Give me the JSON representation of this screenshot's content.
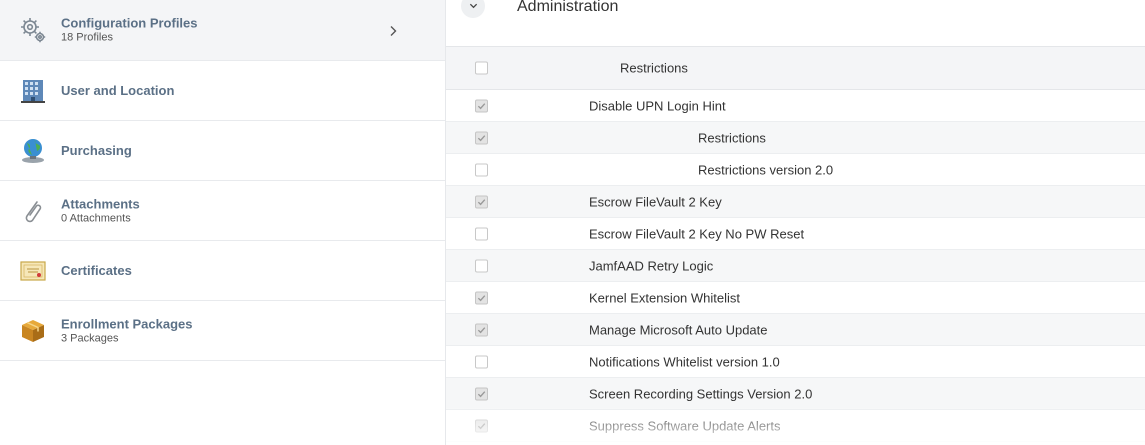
{
  "sidebar": {
    "items": [
      {
        "label": "Configuration Profiles",
        "sub": "18 Profiles",
        "icon": "gear-icon"
      },
      {
        "label": "User and Location",
        "sub": "",
        "icon": "building-icon"
      },
      {
        "label": "Purchasing",
        "sub": "",
        "icon": "globe-icon"
      },
      {
        "label": "Attachments",
        "sub": "0 Attachments",
        "icon": "paperclip-icon"
      },
      {
        "label": "Certificates",
        "sub": "",
        "icon": "certificate-icon"
      },
      {
        "label": "Enrollment Packages",
        "sub": "3 Packages",
        "icon": "package-icon"
      }
    ]
  },
  "main": {
    "section_title": "Administration",
    "header_label": "Restrictions",
    "rows": [
      {
        "label": "Disable UPN Login Hint",
        "checked": true
      },
      {
        "label": "Restrictions",
        "checked": true
      },
      {
        "label": "Restrictions version 2.0",
        "checked": false
      },
      {
        "label": "Escrow FileVault 2 Key",
        "checked": true
      },
      {
        "label": "Escrow FileVault 2 Key No PW Reset",
        "checked": false
      },
      {
        "label": "JamfAAD Retry Logic",
        "checked": false
      },
      {
        "label": "Kernel Extension Whitelist",
        "checked": true
      },
      {
        "label": "Manage Microsoft Auto Update",
        "checked": true
      },
      {
        "label": "Notifications Whitelist version 1.0",
        "checked": false
      },
      {
        "label": "Screen Recording Settings Version 2.0",
        "checked": true
      },
      {
        "label": "Suppress Software Update Alerts",
        "checked": true
      }
    ]
  }
}
